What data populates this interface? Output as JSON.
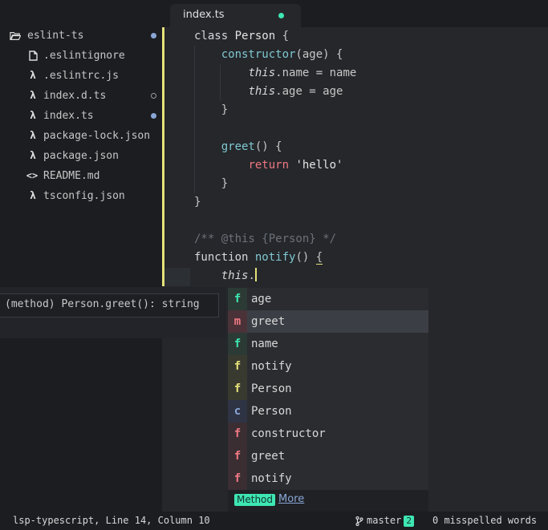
{
  "sidebar": {
    "root": {
      "label": "eslint-ts",
      "icon": "folder-open-icon",
      "status": "modified"
    },
    "files": [
      {
        "label": ".eslintignore",
        "icon": "file-icon",
        "status": ""
      },
      {
        "label": ".eslintrc.js",
        "icon": "lambda-icon",
        "status": ""
      },
      {
        "label": "index.d.ts",
        "icon": "lambda-icon",
        "status": "untracked"
      },
      {
        "label": "index.ts",
        "icon": "lambda-icon",
        "status": "modified"
      },
      {
        "label": "package-lock.json",
        "icon": "lambda-icon",
        "status": ""
      },
      {
        "label": "package.json",
        "icon": "lambda-icon",
        "status": ""
      },
      {
        "label": "README.md",
        "icon": "code-icon",
        "status": ""
      },
      {
        "label": "tsconfig.json",
        "icon": "lambda-icon",
        "status": ""
      }
    ]
  },
  "tab": {
    "label": "index.ts",
    "modified": true
  },
  "code": {
    "l1": {
      "kw": "class",
      "name": "Person",
      "rest": " {"
    },
    "l2": {
      "fn": "constructor",
      "arg": "(age) {"
    },
    "l3": {
      "this": "this",
      "rest": ".name = name"
    },
    "l4": {
      "this": "this",
      "rest": ".age = age"
    },
    "l5": {
      "text": "}"
    },
    "l7": {
      "fn": "greet",
      "rest": "() {"
    },
    "l8": {
      "ret": "return",
      "str": " 'hello'"
    },
    "l9": {
      "text": "}"
    },
    "l10": {
      "text": "}"
    },
    "l12": {
      "comment": "/** @this {Person} */"
    },
    "l13": {
      "kw": "function",
      "fn": "notify",
      "paren": "() ",
      "brace": "{"
    },
    "l14": {
      "this": "this",
      "dot": "."
    }
  },
  "signature_tooltip": {
    "text": "(method) Person.greet(): string"
  },
  "autocomplete": {
    "items": [
      {
        "type": "f",
        "label": "age",
        "color": "#3ee6b2",
        "bg": "#2c3a35"
      },
      {
        "type": "m",
        "label": "greet",
        "color": "#f07882",
        "bg": "#4a3238",
        "selected": true
      },
      {
        "type": "f",
        "label": "name",
        "color": "#3ee6b2",
        "bg": "#2c3a35"
      },
      {
        "type": "f",
        "label": "notify",
        "color": "#e6e27a",
        "bg": "#393a2f"
      },
      {
        "type": "f",
        "label": "Person",
        "color": "#e6e27a",
        "bg": "#393a2f"
      },
      {
        "type": "c",
        "label": "Person",
        "color": "#8aa6d6",
        "bg": "#2f3444"
      },
      {
        "type": "f",
        "label": "constructor",
        "color": "#f07882",
        "bg": "#3a2e33"
      },
      {
        "type": "f",
        "label": "greet",
        "color": "#f07882",
        "bg": "#3a2e33"
      },
      {
        "type": "f",
        "label": "notify",
        "color": "#f07882",
        "bg": "#3a2e33"
      }
    ],
    "footer": {
      "kind": "Method",
      "more": "More"
    }
  },
  "statusbar": {
    "left": "lsp-typescript, Line 14, Column 10",
    "branch": "master",
    "branch_count": "2",
    "spell": "0 misspelled words"
  }
}
